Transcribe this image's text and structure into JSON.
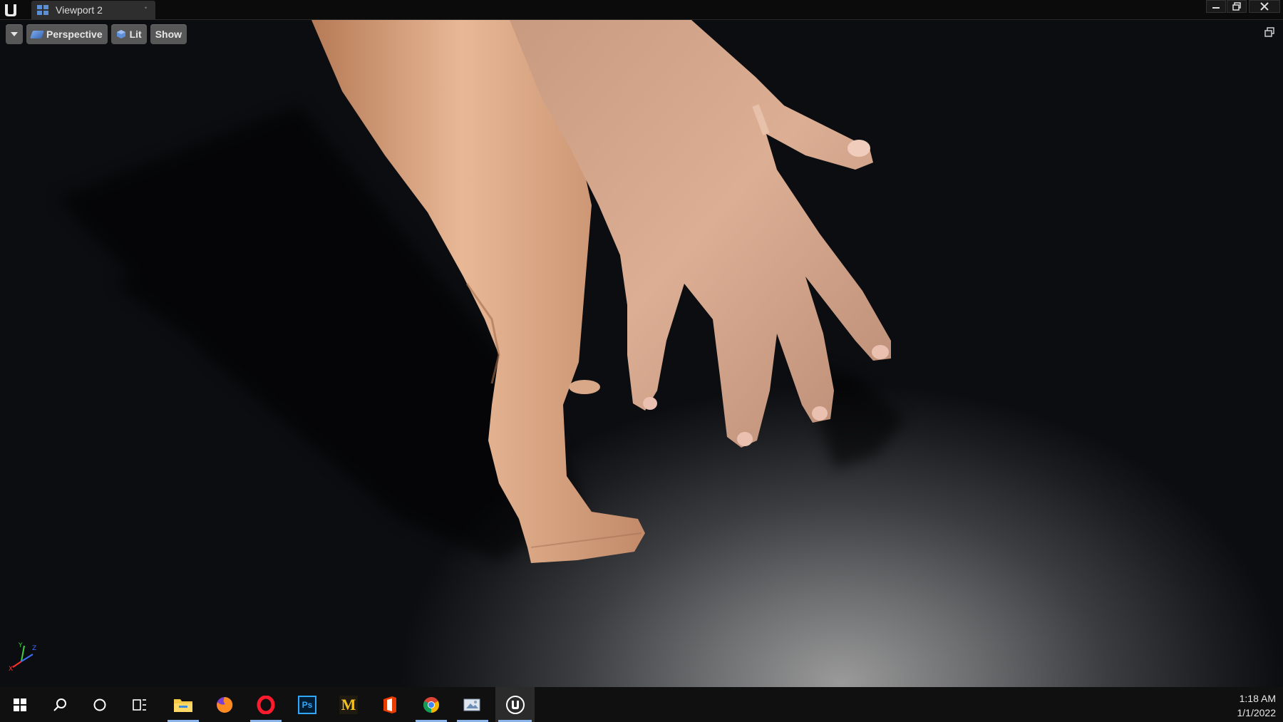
{
  "window": {
    "tab_title": "Viewport 2"
  },
  "viewport_toolbar": {
    "perspective_label": "Perspective",
    "lit_label": "Lit",
    "show_label": "Show"
  },
  "axis_gizmo": {
    "x_label": "X",
    "y_label": "Y",
    "z_label": "Z"
  },
  "taskbar": {
    "items": [
      {
        "icon": "windows-start-icon"
      },
      {
        "icon": "search-icon"
      },
      {
        "icon": "cortana-icon"
      },
      {
        "icon": "task-view-icon"
      },
      {
        "icon": "file-explorer-icon"
      },
      {
        "icon": "firefox-icon"
      },
      {
        "icon": "opera-icon"
      },
      {
        "icon": "photoshop-icon",
        "text": "Ps"
      },
      {
        "icon": "app-m-icon",
        "text": "M"
      },
      {
        "icon": "office-icon"
      },
      {
        "icon": "chrome-icon"
      },
      {
        "icon": "photos-icon"
      },
      {
        "icon": "unreal-engine-icon",
        "active": true
      }
    ],
    "clock": {
      "time": "1:18 AM",
      "date": "1/1/2022"
    }
  },
  "colors": {
    "accent": "#8ab4e8",
    "skin": "#d9a98a"
  }
}
